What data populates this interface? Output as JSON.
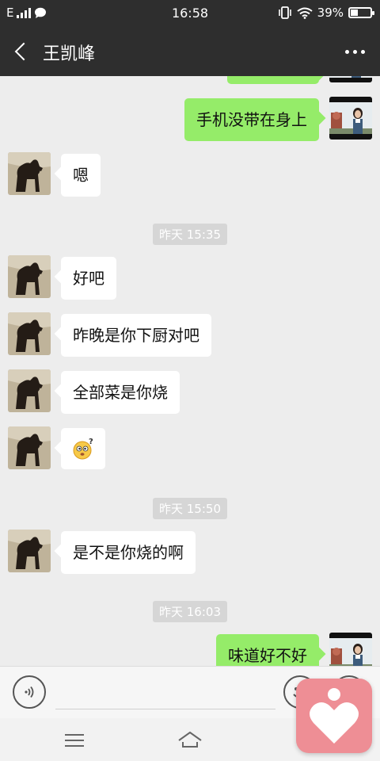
{
  "status_bar": {
    "network": "E",
    "time": "16:58",
    "battery": "39%",
    "battery_level": 0.39,
    "icons": [
      "signal-icon",
      "chat-notification-icon",
      "vibrate-icon",
      "wifi-icon",
      "battery-icon"
    ]
  },
  "header": {
    "title": "王凯峰",
    "back_icon": "back-arrow-icon",
    "more_icon": "more-icon"
  },
  "messages": [
    {
      "type": "message",
      "direction": "out",
      "text": ""
    },
    {
      "type": "message",
      "direction": "out",
      "text": "手机没带在身上"
    },
    {
      "type": "message",
      "direction": "in",
      "text": "嗯"
    },
    {
      "type": "timestamp",
      "text": "昨天 15:35"
    },
    {
      "type": "message",
      "direction": "in",
      "text": "好吧"
    },
    {
      "type": "message",
      "direction": "in",
      "text": "昨晚是你下厨对吧"
    },
    {
      "type": "message",
      "direction": "in",
      "text": "全部菜是你烧"
    },
    {
      "type": "message",
      "direction": "in",
      "emoji": "confused-emoji"
    },
    {
      "type": "timestamp",
      "text": "昨天 15:50"
    },
    {
      "type": "message",
      "direction": "in",
      "text": "是不是你烧的啊"
    },
    {
      "type": "timestamp",
      "text": "昨天 16:03"
    },
    {
      "type": "message",
      "direction": "out",
      "text": "味道好不好"
    }
  ],
  "input_bar": {
    "value": "",
    "icons": [
      "voice-icon",
      "emoji-icon",
      "plus-icon"
    ]
  },
  "nav_bar": {
    "icons": [
      "menu-icon",
      "home-icon"
    ]
  },
  "colors": {
    "header_bg": "#2e2e2e",
    "chat_bg": "#ededed",
    "outgoing_bubble": "#95ec69",
    "incoming_bubble": "#ffffff",
    "floating_app": "#ee8e95"
  }
}
